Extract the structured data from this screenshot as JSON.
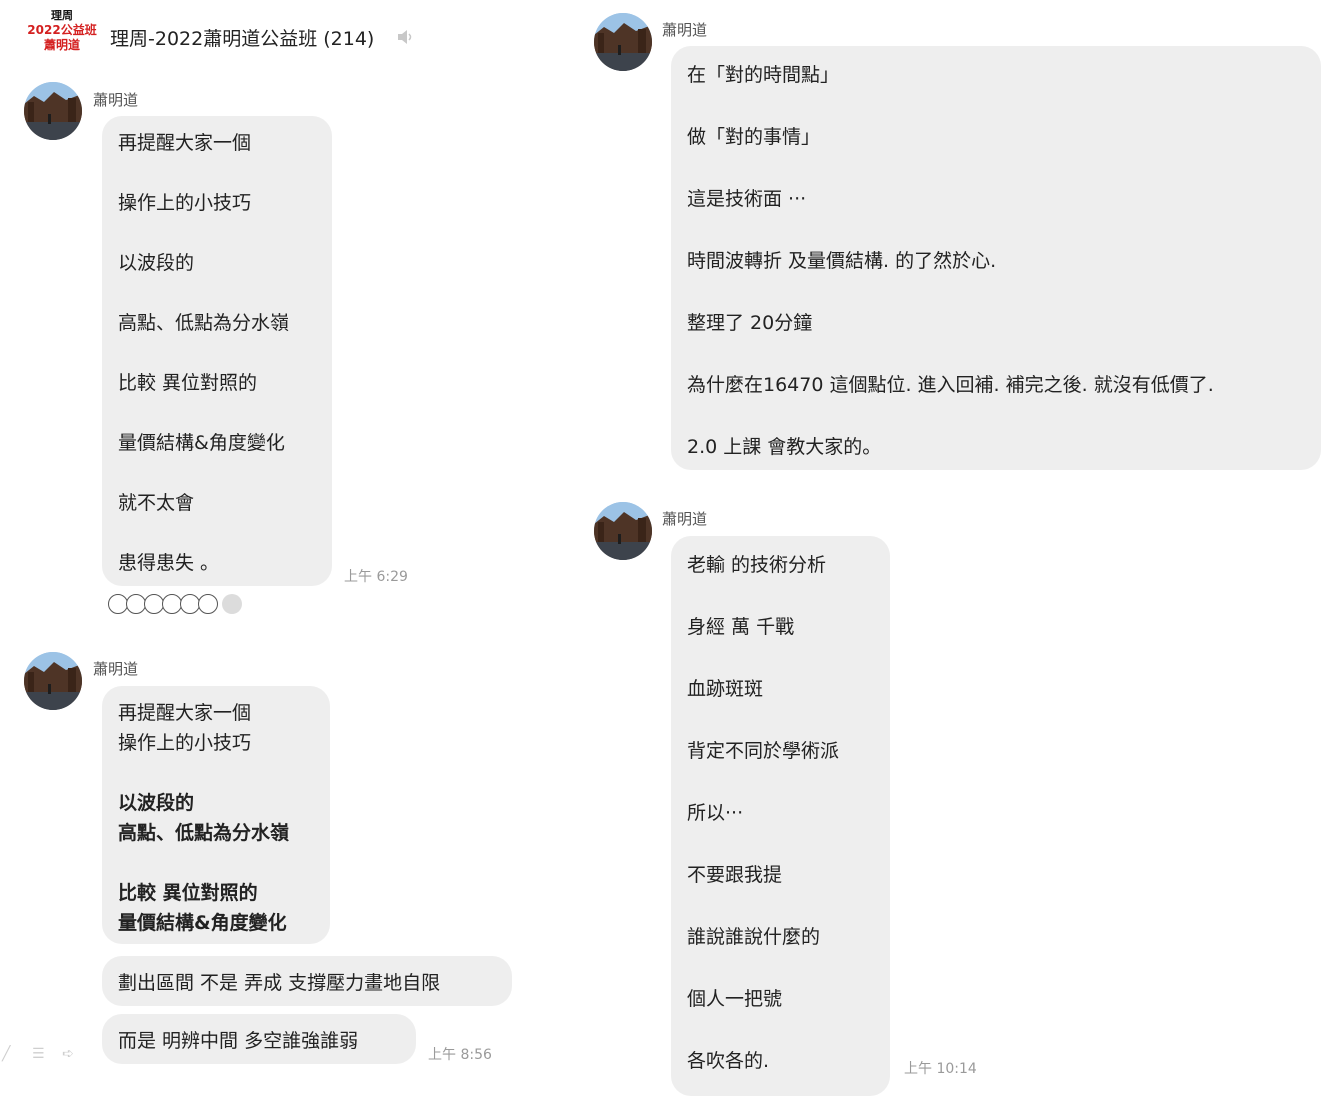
{
  "header": {
    "logo_line1": "理周",
    "logo_line2": "2022公益班",
    "logo_line3": "蕭明道",
    "title": "理周-2022蕭明道公益班 (214)"
  },
  "left": {
    "msg1": {
      "sender": "蕭明道",
      "lines": [
        "再提醒大家一個",
        "操作上的小技巧",
        "以波段的",
        "高點、低點為分水嶺",
        "比較 異位對照的",
        "量價結構&角度變化",
        "就不太會",
        "患得患失 。"
      ],
      "time": "上午 6:29"
    },
    "msg2": {
      "sender": "蕭明道",
      "lines": [
        "再提醒大家一個",
        "操作上的小技巧",
        "以波段的",
        "高點、低點為分水嶺",
        "比較 異位對照的",
        "量價結構&角度變化"
      ],
      "line2": "劃出區間 不是 弄成 支撐壓力畫地自限",
      "line3": "而是 明辨中間 多空誰強誰弱",
      "time": "上午 8:56"
    }
  },
  "right": {
    "msg1": {
      "sender": "蕭明道",
      "lines": [
        "在「對的時間點」",
        "做「對的事情」",
        "這是技術面 ···",
        "時間波轉折 及量價結構. 的了然於心.",
        "整理了 20分鐘",
        "為什麼在16470 這個點位. 進入回補. 補完之後. 就沒有低價了.",
        "2.0 上課 會教大家的。"
      ]
    },
    "msg2": {
      "sender": "蕭明道",
      "lines": [
        "老輸 的技術分析",
        "身經 萬 千戰",
        "血跡斑斑",
        "背定不同於學術派",
        "所以···",
        "不要跟我提",
        "誰說誰說什麼的",
        "個人一把號",
        "各吹各的."
      ],
      "time": "上午 10:14"
    }
  },
  "colors": {
    "bubble": "#eeeeee",
    "logo_red": "#d42020",
    "timestamp": "#9a9a9a"
  }
}
